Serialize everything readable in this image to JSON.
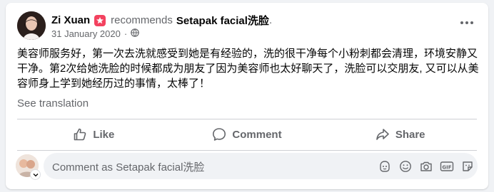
{
  "post": {
    "author": "Zi Xuan",
    "recommends_text": "recommends",
    "page_name": "Setapak facial洗脸",
    "page_name_suffix": ".",
    "date": "31 January 2020",
    "privacy_icon": "globe-icon",
    "body": "美容师服务好，第一次去洗就感受到她是有经验的，洗的很干净每个小粉刺都会清理，环境安静又干净。第2次给她洗脸的时候都成为朋友了因为美容师也太好聊天了，洗脸可以交朋友, 又可以从美容师身上学到她经历过的事情，太棒了！",
    "see_translation": "See translation"
  },
  "actions": {
    "like": "Like",
    "comment": "Comment",
    "share": "Share"
  },
  "comment_composer": {
    "placeholder": "Comment as Setapak facial洗脸",
    "icons": [
      "avatar-sticker-icon",
      "emoji-icon",
      "camera-icon",
      "gif-icon",
      "sticker-icon"
    ]
  },
  "colors": {
    "recommend_badge": "#f3425f",
    "secondary_text": "#65676b",
    "background": "#f0f2f5"
  }
}
